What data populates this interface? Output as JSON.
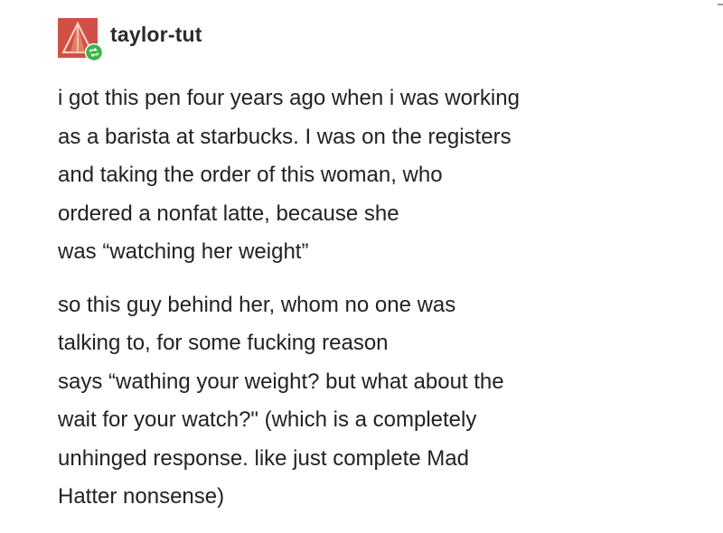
{
  "post": {
    "username": "taylor-tut",
    "avatar_icon": "pyramid-avatar-icon",
    "badge_icon": "reblog-icon",
    "colors": {
      "avatar_bg": "#d9534a",
      "badge": "#3cb44b",
      "text": "#222222"
    },
    "paragraphs": [
      {
        "lines": [
          "i got this pen four years ago when i was working",
          "as a barista at starbucks. I was on the registers",
          "and taking the order of this woman, who",
          "ordered a nonfat latte, because she",
          "was “watching her weight”"
        ]
      },
      {
        "lines": [
          "so this guy behind her, whom no one was",
          "talking to, for some fucking reason",
          "says “wathing your weight? but what about the",
          "wait for your watch?\" (which is a completely",
          "unhinged response. like just complete Mad",
          "Hatter nonsense)"
        ]
      }
    ]
  }
}
